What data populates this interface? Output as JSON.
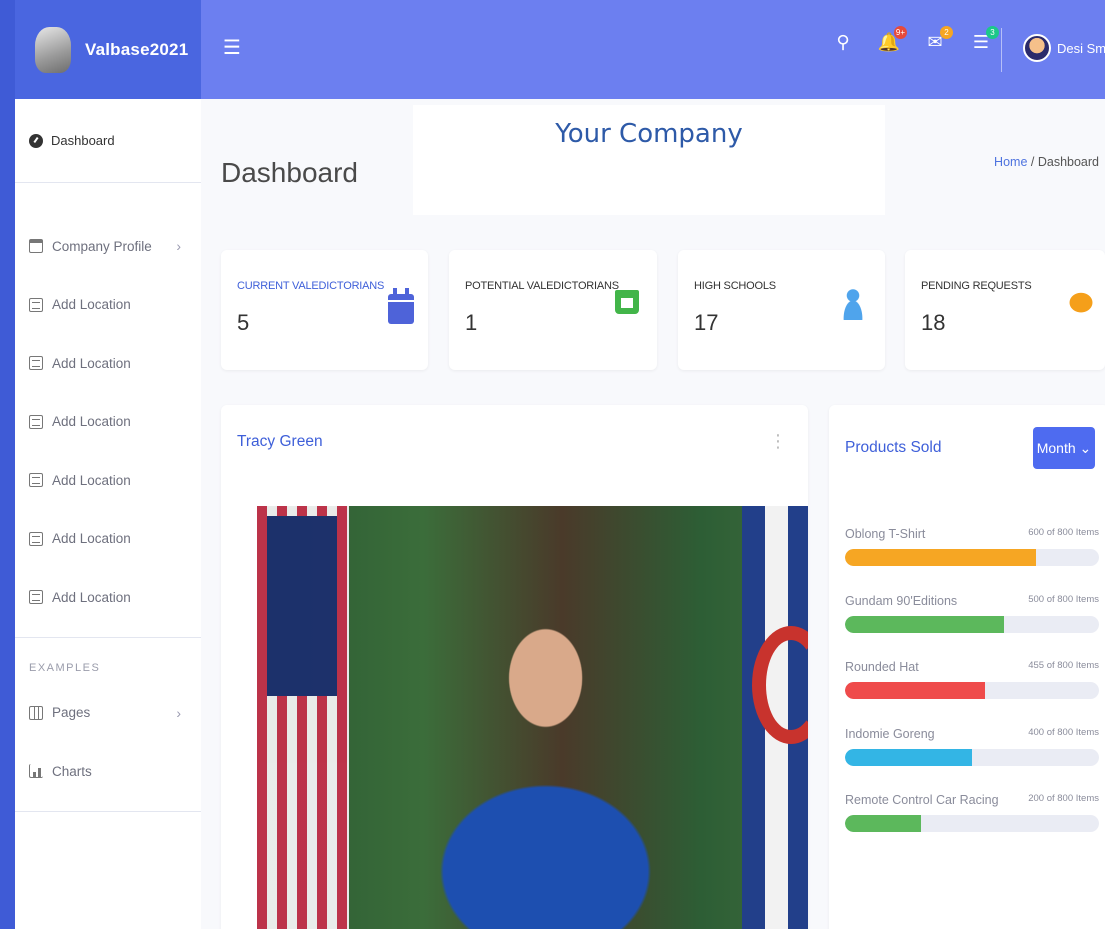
{
  "brand": {
    "name": "Valbase2021"
  },
  "topbar": {
    "badges": {
      "alerts": "9+",
      "messages": "2",
      "tasks": "3"
    },
    "user_name": "Desi Smith"
  },
  "sidebar": {
    "dashboard_label": "Dashboard",
    "items": [
      {
        "label": "Company Profile",
        "icon": "window-icon",
        "has_chevron": true
      },
      {
        "label": "Add Location",
        "icon": "document-icon"
      },
      {
        "label": "Add Location",
        "icon": "document-icon"
      },
      {
        "label": "Add Location",
        "icon": "document-icon"
      },
      {
        "label": "Add Location",
        "icon": "document-icon"
      },
      {
        "label": "Add Location",
        "icon": "document-icon"
      },
      {
        "label": "Add Location",
        "icon": "document-icon"
      }
    ],
    "examples_heading": "EXAMPLES",
    "examples": [
      {
        "label": "Pages",
        "icon": "columns-icon",
        "has_chevron": true
      },
      {
        "label": "Charts",
        "icon": "area-chart-icon"
      }
    ]
  },
  "header": {
    "company": "Your Company",
    "title": "Dashboard",
    "breadcrumb": {
      "home": "Home",
      "separator": "/",
      "current": "Dashboard"
    }
  },
  "stats": [
    {
      "label": "CURRENT VALEDICTORIANS",
      "value": "5",
      "icon": "calendar-icon",
      "color": "#4e63d9"
    },
    {
      "label": "POTENTIAL VALEDICTORIANS",
      "value": "1",
      "icon": "cart-icon",
      "color": "#42b549"
    },
    {
      "label": "HIGH SCHOOLS",
      "value": "17",
      "icon": "users-icon",
      "color": "#4fa4ec"
    },
    {
      "label": "PENDING REQUESTS",
      "value": "18",
      "icon": "chat-icon",
      "color": "#f59f1a"
    }
  ],
  "video_panel": {
    "title": "Tracy Green"
  },
  "products_panel": {
    "title": "Products Sold",
    "filter_label": "Month",
    "products": [
      {
        "name": "Oblong T-Shirt",
        "count": "600 of 800 Items",
        "progress": 0.75,
        "color": "#f6a623"
      },
      {
        "name": "Gundam 90'Editions",
        "count": "500 of 800 Items",
        "progress": 0.625,
        "color": "#5cb85c"
      },
      {
        "name": "Rounded Hat",
        "count": "455 of 800 Items",
        "progress": 0.55,
        "color": "#ef4b4b"
      },
      {
        "name": "Indomie Goreng",
        "count": "400 of 800 Items",
        "progress": 0.5,
        "color": "#33b5e5"
      },
      {
        "name": "Remote Control Car Racing",
        "count": "200 of 800 Items",
        "progress": 0.3,
        "color": "#5cb85c"
      }
    ]
  }
}
